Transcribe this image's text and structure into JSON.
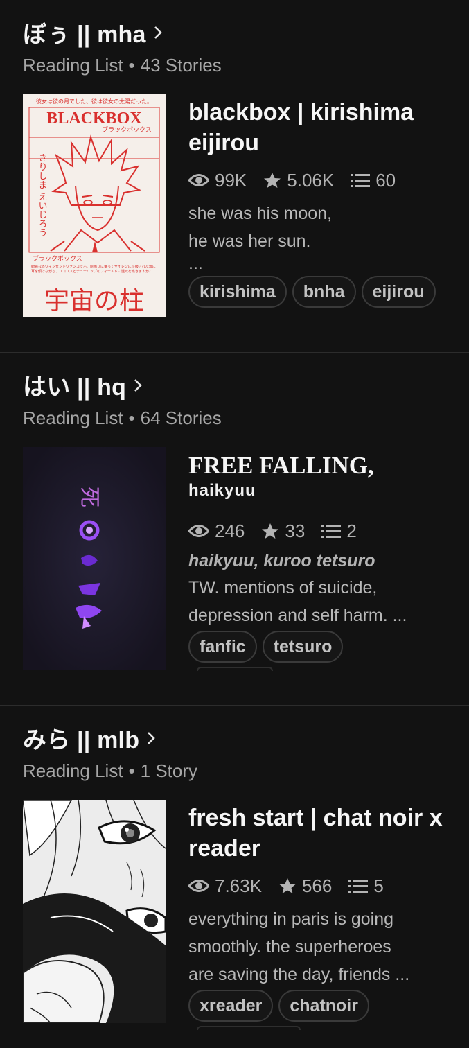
{
  "lists": [
    {
      "title": "ぼぅ || mha",
      "label": "Reading List",
      "count": "43 Stories",
      "story": {
        "title": "blackbox | kirishima eijirou",
        "subtitle": "",
        "reads": "99K",
        "votes": "5.06K",
        "parts": "60",
        "italic_tags": "",
        "description_lines": [
          "she was his moon,",
          "he was her sun.",
          "..."
        ],
        "tags": [
          "kirishima",
          "bnha",
          "eijirou"
        ],
        "cover": {
          "top_text": "彼女は彼の月でした、彼は彼女の太陽だった。",
          "brand": "BLACKBOX",
          "brand_kana": "ブラックボックス",
          "side_text": "きりしま えいじろう",
          "kana2": "ブラックボックス",
          "small_text": "綺麗なるヴィンセントヴァンゴッホ、絵画りに乗ってサイレンに征服された波に耳を傾けながら、リコリスとチューリップのフィールドに還元を築きますか？",
          "bottom_text": "宇宙の柱",
          "accent": "#d9302e",
          "bg": "#f5efea"
        }
      }
    },
    {
      "title": "はい || hq",
      "label": "Reading List",
      "count": "64 Stories",
      "story": {
        "title": "FREE FALLING,",
        "subtitle": "haikyuu",
        "reads": "246",
        "votes": "33",
        "parts": "2",
        "italic_tags": "haikyuu, kuroo tetsuro",
        "description_lines": [
          "TW. mentions of suicide,",
          "depression and self harm. ..."
        ],
        "tags": [
          "fanfic",
          "tetsuro"
        ],
        "cover": {
          "glyph": "死",
          "bg": "#1d1a2e",
          "accent": "#8a3cf0"
        }
      }
    },
    {
      "title": "みら || mlb",
      "label": "Reading List",
      "count": "1 Story",
      "story": {
        "title": "fresh start | chat noir x reader",
        "subtitle": "",
        "reads": "7.63K",
        "votes": "566",
        "parts": "5",
        "italic_tags": "",
        "description_lines": [
          "everything in paris is going",
          "smoothly. the superheroes",
          "are saving the day, friends ..."
        ],
        "tags": [
          "xreader",
          "chatnoir"
        ],
        "cover": {
          "bg": "#e8e8e8"
        }
      }
    }
  ],
  "colors": {
    "background": "#121212",
    "text_primary": "#f2f2f2",
    "text_secondary": "#a6a6a6",
    "divider": "#2c2c2c"
  },
  "icons": {
    "reads": "eye-icon",
    "votes": "star-icon",
    "parts": "list-icon",
    "chevron": "chevron-right-icon"
  }
}
